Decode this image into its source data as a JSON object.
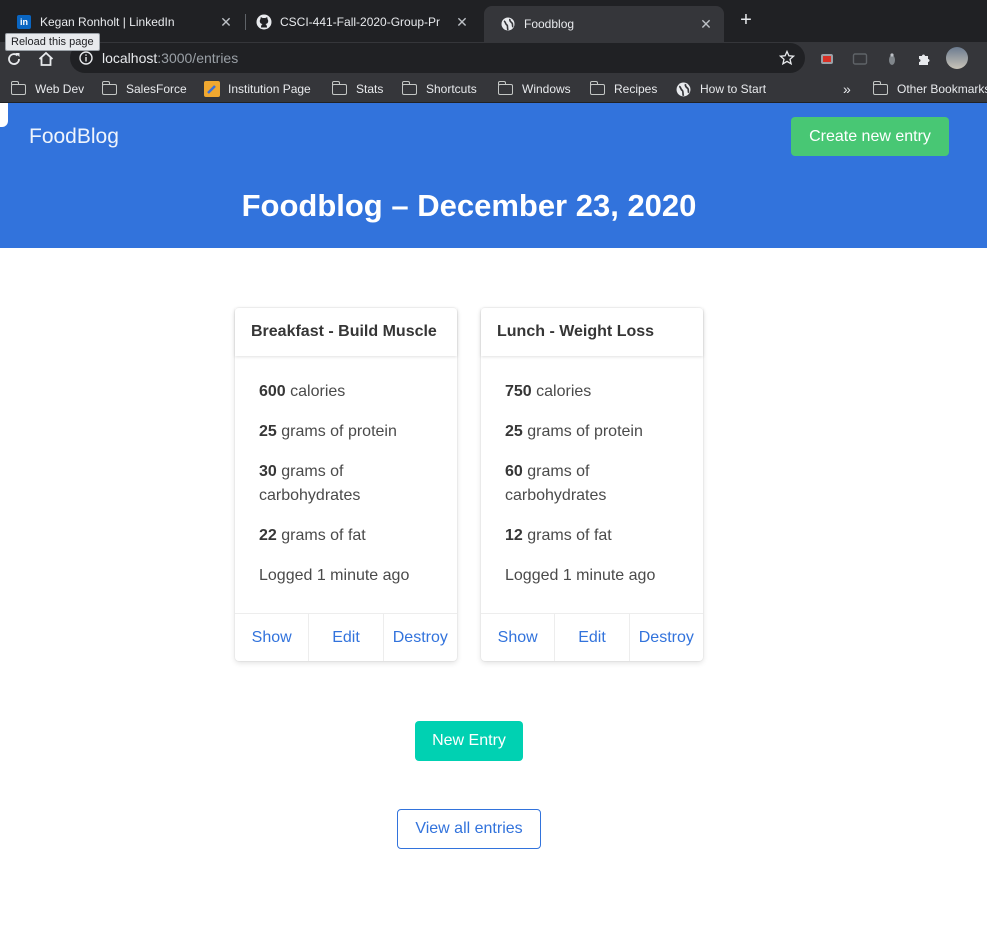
{
  "browser": {
    "tabs": [
      {
        "title": "Kegan Ronholt | LinkedIn",
        "icon": "linkedin-icon"
      },
      {
        "title": "CSCI-441-Fall-2020-Group-Pr",
        "icon": "github-icon"
      },
      {
        "title": "Foodblog",
        "icon": "globe-icon"
      }
    ],
    "tooltip": "Reload this page",
    "url_host": "localhost",
    "url_path": ":3000/entries",
    "bookmarks": [
      "Web Dev",
      "SalesForce",
      "Institution Page",
      "Stats",
      "Shortcuts",
      "Windows",
      "Recipes",
      "How to Start"
    ],
    "overflow": "»",
    "other_bookmarks": "Other Bookmarks"
  },
  "navbar": {
    "brand": "FoodBlog",
    "create_label": "Create new entry"
  },
  "hero": {
    "title": "Foodblog – December 23, 2020"
  },
  "entries": [
    {
      "title": "Breakfast - Build Muscle",
      "calories": "600",
      "calories_label": "calories",
      "protein": "25",
      "protein_label": "grams of protein",
      "carbs": "30",
      "carbs_label": "grams of carbohydrates",
      "fat": "22",
      "fat_label": "grams of fat",
      "logged": "Logged 1 minute ago",
      "actions": [
        "Show",
        "Edit",
        "Destroy"
      ]
    },
    {
      "title": "Lunch - Weight Loss",
      "calories": "750",
      "calories_label": "calories",
      "protein": "25",
      "protein_label": "grams of protein",
      "carbs": "60",
      "carbs_label": "grams of carbohydrates",
      "fat": "12",
      "fat_label": "grams of fat",
      "logged": "Logged 1 minute ago",
      "actions": [
        "Show",
        "Edit",
        "Destroy"
      ]
    }
  ],
  "buttons": {
    "new_entry": "New Entry",
    "view_all": "View all entries"
  },
  "colors": {
    "hero": "#3273dc",
    "create_button": "#48c774",
    "new_entry_button": "#00d1b2",
    "link": "#3273dc"
  }
}
